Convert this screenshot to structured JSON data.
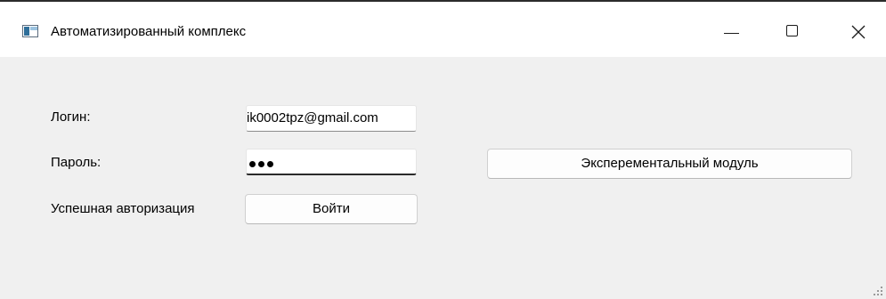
{
  "window": {
    "title": "Автоматизированный комплекс",
    "icon": "app-window-icon",
    "controls": {
      "minimize": "minimize-icon",
      "maximize": "maximize-icon",
      "close": "close-icon"
    }
  },
  "form": {
    "login_label": "Логин:",
    "login_value": "ik0002tpz@gmail.com",
    "password_label": "Пароль:",
    "password_masked_length": 3,
    "status_text": "Успешная авторизация",
    "login_button": "Войти"
  },
  "experimental_button": "Эксперементальный модуль",
  "colors": {
    "background": "#f0f0f0",
    "titlebar": "#ffffff",
    "icon_accent": "#2f6f9a"
  }
}
